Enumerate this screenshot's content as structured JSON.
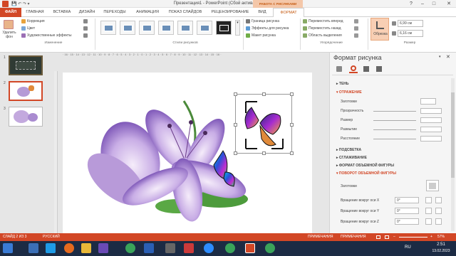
{
  "window": {
    "title": "Презентация1 - PowerPoint (Сбой активации продукта)",
    "context_group": "РАБОТА С РИСУНКАМИ",
    "help": "?",
    "minimize": "–",
    "restore": "□",
    "close": "✕"
  },
  "tabs": [
    "ФАЙЛ",
    "ГЛАВНАЯ",
    "ВСТАВКА",
    "ДИЗАЙН",
    "ПЕРЕХОДЫ",
    "АНИМАЦИЯ",
    "ПОКАЗ СЛАЙДОВ",
    "РЕЦЕНЗИРОВАНИЕ",
    "ВИД",
    "ФОРМАТ"
  ],
  "ribbon": {
    "remove_bg": "Удалить фон",
    "correction": "Коррекция",
    "color": "Цвет",
    "artistic": "Художественные эффекты",
    "group_change": "Изменение",
    "group_styles": "Стили рисунков",
    "border": "Граница рисунка",
    "effects": "Эффекты для рисунка",
    "layout": "Макет рисунка",
    "bring_forward": "Переместить вперед",
    "send_backward": "Переместить назад",
    "selection_pane": "Область выделения",
    "group_arrange": "Упорядочение",
    "crop": "Обрезка",
    "height": "6,99 см",
    "width": "6,16 см",
    "group_size": "Размер"
  },
  "ruler_text": "· 16 · 15 · 14 · 13 · 12 · 11 · 10 · 9 · 8 · 7 · 6 · 5 · 4 · 3 · 2 · 1 · 0 · 1 · 2 · 3 · 4 · 5 · 6 · 7 · 8 · 9 · 10 · 11 · 12 · 13 · 14 · 15 · 16 ·",
  "slides": [
    "1",
    "2",
    "3"
  ],
  "pane": {
    "title": "Формат рисунка",
    "close": "✕",
    "shadow": "ТЕНЬ",
    "reflection": "ОТРАЖЕНИЕ",
    "presets": "Заготовки",
    "transparency": "Прозрачность",
    "size": "Размер",
    "blur": "Размытие",
    "distance": "Расстояние",
    "glow": "ПОДСВЕТКА",
    "soft_edges": "СГЛАЖИВАНИЕ",
    "format_3d": "ФОРМАТ ОБЪЕМНОЙ ФИГУРЫ",
    "rotation_3d": "ПОВОРОТ ОБЪЕМНОЙ ФИГУРЫ",
    "presets2": "Заготовки",
    "rot_x": "Вращение вокруг оси X",
    "rot_y": "Вращение вокруг оси Y",
    "rot_z": "Вращение вокруг оси Z",
    "rot_x_val": "0°",
    "rot_y_val": "0°",
    "rot_z_val": "0°"
  },
  "status": {
    "slide": "СЛАЙД 2 ИЗ 3",
    "lang": "РУССКИЙ",
    "notes": "ПРИМЕЧАНИЯ",
    "comments": "ПРИМЕЧАНИЯ",
    "zoom": "57%"
  },
  "taskbar": {
    "lang": "RU",
    "time": "2:51",
    "date": "13.02.2023"
  },
  "colors": {
    "accent": "#d24726",
    "context": "#c55a11",
    "taskbar": "#1c2b44"
  }
}
